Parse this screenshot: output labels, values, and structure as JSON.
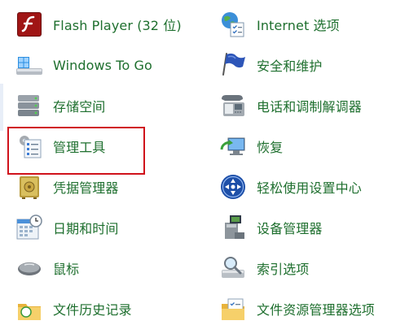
{
  "left_column": [
    {
      "id": "flash",
      "label": "Flash Player (32 位)",
      "icon": "flash-icon"
    },
    {
      "id": "windows-to-go",
      "label": "Windows To Go",
      "icon": "usb-drive-icon"
    },
    {
      "id": "storage-spaces",
      "label": "存储空间",
      "icon": "storage-spaces-icon"
    },
    {
      "id": "admin-tools",
      "label": "管理工具",
      "icon": "admin-tools-icon"
    },
    {
      "id": "credential-manager",
      "label": "凭据管理器",
      "icon": "safe-icon"
    },
    {
      "id": "date-time",
      "label": "日期和时间",
      "icon": "calendar-clock-icon"
    },
    {
      "id": "mouse",
      "label": "鼠标",
      "icon": "mouse-icon"
    },
    {
      "id": "file-history",
      "label": "文件历史记录",
      "icon": "folder-history-icon"
    }
  ],
  "right_column": [
    {
      "id": "internet-options",
      "label": "Internet 选项",
      "icon": "globe-checklist-icon"
    },
    {
      "id": "security-maintenance",
      "label": "安全和维护",
      "icon": "flag-icon"
    },
    {
      "id": "phone-modem",
      "label": "电话和调制解调器",
      "icon": "telephone-icon"
    },
    {
      "id": "recovery",
      "label": "恢复",
      "icon": "recovery-icon"
    },
    {
      "id": "ease-of-access",
      "label": "轻松使用设置中心",
      "icon": "ease-of-access-icon"
    },
    {
      "id": "device-manager",
      "label": "设备管理器",
      "icon": "device-manager-icon"
    },
    {
      "id": "indexing-options",
      "label": "索引选项",
      "icon": "magnifier-icon"
    },
    {
      "id": "explorer-options",
      "label": "文件资源管理器选项",
      "icon": "folder-options-icon"
    }
  ],
  "highlighted_item": "admin-tools",
  "colors": {
    "label": "#1e6f2e",
    "highlight_border": "#d0121b"
  }
}
